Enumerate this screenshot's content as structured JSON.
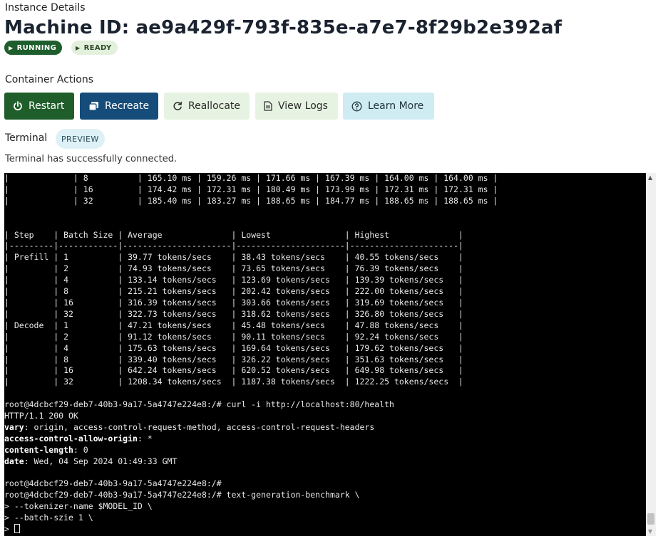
{
  "header": {
    "section_label": "Instance Details",
    "title": "Machine ID: ae9a429f-793f-835e-a7e7-8f29b2e392af",
    "badges": [
      {
        "label": "RUNNING",
        "icon": "play-icon"
      },
      {
        "label": "READY",
        "icon": "play-icon"
      }
    ]
  },
  "actions": {
    "section_label": "Container Actions",
    "buttons": [
      {
        "label": "Restart",
        "icon": "power-icon"
      },
      {
        "label": "Recreate",
        "icon": "copy-icon"
      },
      {
        "label": "Reallocate",
        "icon": "refresh-icon"
      },
      {
        "label": "View Logs",
        "icon": "document-icon"
      },
      {
        "label": "Learn More",
        "icon": "help-circle-icon"
      }
    ]
  },
  "terminal": {
    "label": "Terminal",
    "badge": "PREVIEW",
    "status": "Terminal has successfully connected.",
    "lines": [
      {
        "text": "|             | 8          | 165.10 ms | 159.26 ms | 171.66 ms | 167.39 ms | 164.00 ms | 164.00 ms |"
      },
      {
        "text": "|             | 16         | 174.42 ms | 172.31 ms | 180.49 ms | 173.99 ms | 172.31 ms | 172.31 ms |"
      },
      {
        "text": "|             | 32         | 185.40 ms | 183.27 ms | 188.65 ms | 184.77 ms | 188.65 ms | 188.65 ms |"
      },
      {
        "text": ""
      },
      {
        "text": ""
      },
      {
        "text": "| Step    | Batch Size | Average              | Lowest               | Highest              |"
      },
      {
        "text": "|---------|------------|----------------------|----------------------|----------------------|"
      },
      {
        "text": "| Prefill | 1          | 39.77 tokens/secs    | 38.43 tokens/secs    | 40.55 tokens/secs    |"
      },
      {
        "text": "|         | 2          | 74.93 tokens/secs    | 73.65 tokens/secs    | 76.39 tokens/secs    |"
      },
      {
        "text": "|         | 4          | 133.14 tokens/secs   | 123.69 tokens/secs   | 139.39 tokens/secs   |"
      },
      {
        "text": "|         | 8          | 215.21 tokens/secs   | 202.42 tokens/secs   | 222.00 tokens/secs   |"
      },
      {
        "text": "|         | 16         | 316.39 tokens/secs   | 303.66 tokens/secs   | 319.69 tokens/secs   |"
      },
      {
        "text": "|         | 32         | 322.73 tokens/secs   | 318.62 tokens/secs   | 326.80 tokens/secs   |"
      },
      {
        "text": "| Decode  | 1          | 47.21 tokens/secs    | 45.48 tokens/secs    | 47.88 tokens/secs    |"
      },
      {
        "text": "|         | 2          | 91.12 tokens/secs    | 90.11 tokens/secs    | 92.24 tokens/secs    |"
      },
      {
        "text": "|         | 4          | 175.63 tokens/secs   | 169.64 tokens/secs   | 179.62 tokens/secs   |"
      },
      {
        "text": "|         | 8          | 339.40 tokens/secs   | 326.22 tokens/secs   | 351.63 tokens/secs   |"
      },
      {
        "text": "|         | 16         | 642.24 tokens/secs   | 620.52 tokens/secs   | 649.98 tokens/secs   |"
      },
      {
        "text": "|         | 32         | 1208.34 tokens/secs  | 1187.38 tokens/secs  | 1222.25 tokens/secs  |"
      },
      {
        "text": ""
      },
      {
        "text": "root@4dcbcf29-deb7-40b3-9a17-5a4747e224e8:/# curl -i http://localhost:80/health"
      },
      {
        "text": "HTTP/1.1 200 OK"
      },
      {
        "key": "vary",
        "text": ": origin, access-control-request-method, access-control-request-headers"
      },
      {
        "key": "access-control-allow-origin",
        "text": ": *"
      },
      {
        "key": "content-length",
        "text": ": 0"
      },
      {
        "key": "date",
        "text": ": Wed, 04 Sep 2024 01:49:33 GMT"
      },
      {
        "text": ""
      },
      {
        "text": "root@4dcbcf29-deb7-40b3-9a17-5a4747e224e8:/#"
      },
      {
        "text": "root@4dcbcf29-deb7-40b3-9a17-5a4747e224e8:/# text-generation-benchmark \\"
      },
      {
        "text": "> --tokenizer-name $MODEL_ID \\"
      },
      {
        "text": "> --batch-szie 1 \\"
      },
      {
        "text": "> ",
        "cursor": true
      }
    ]
  }
}
